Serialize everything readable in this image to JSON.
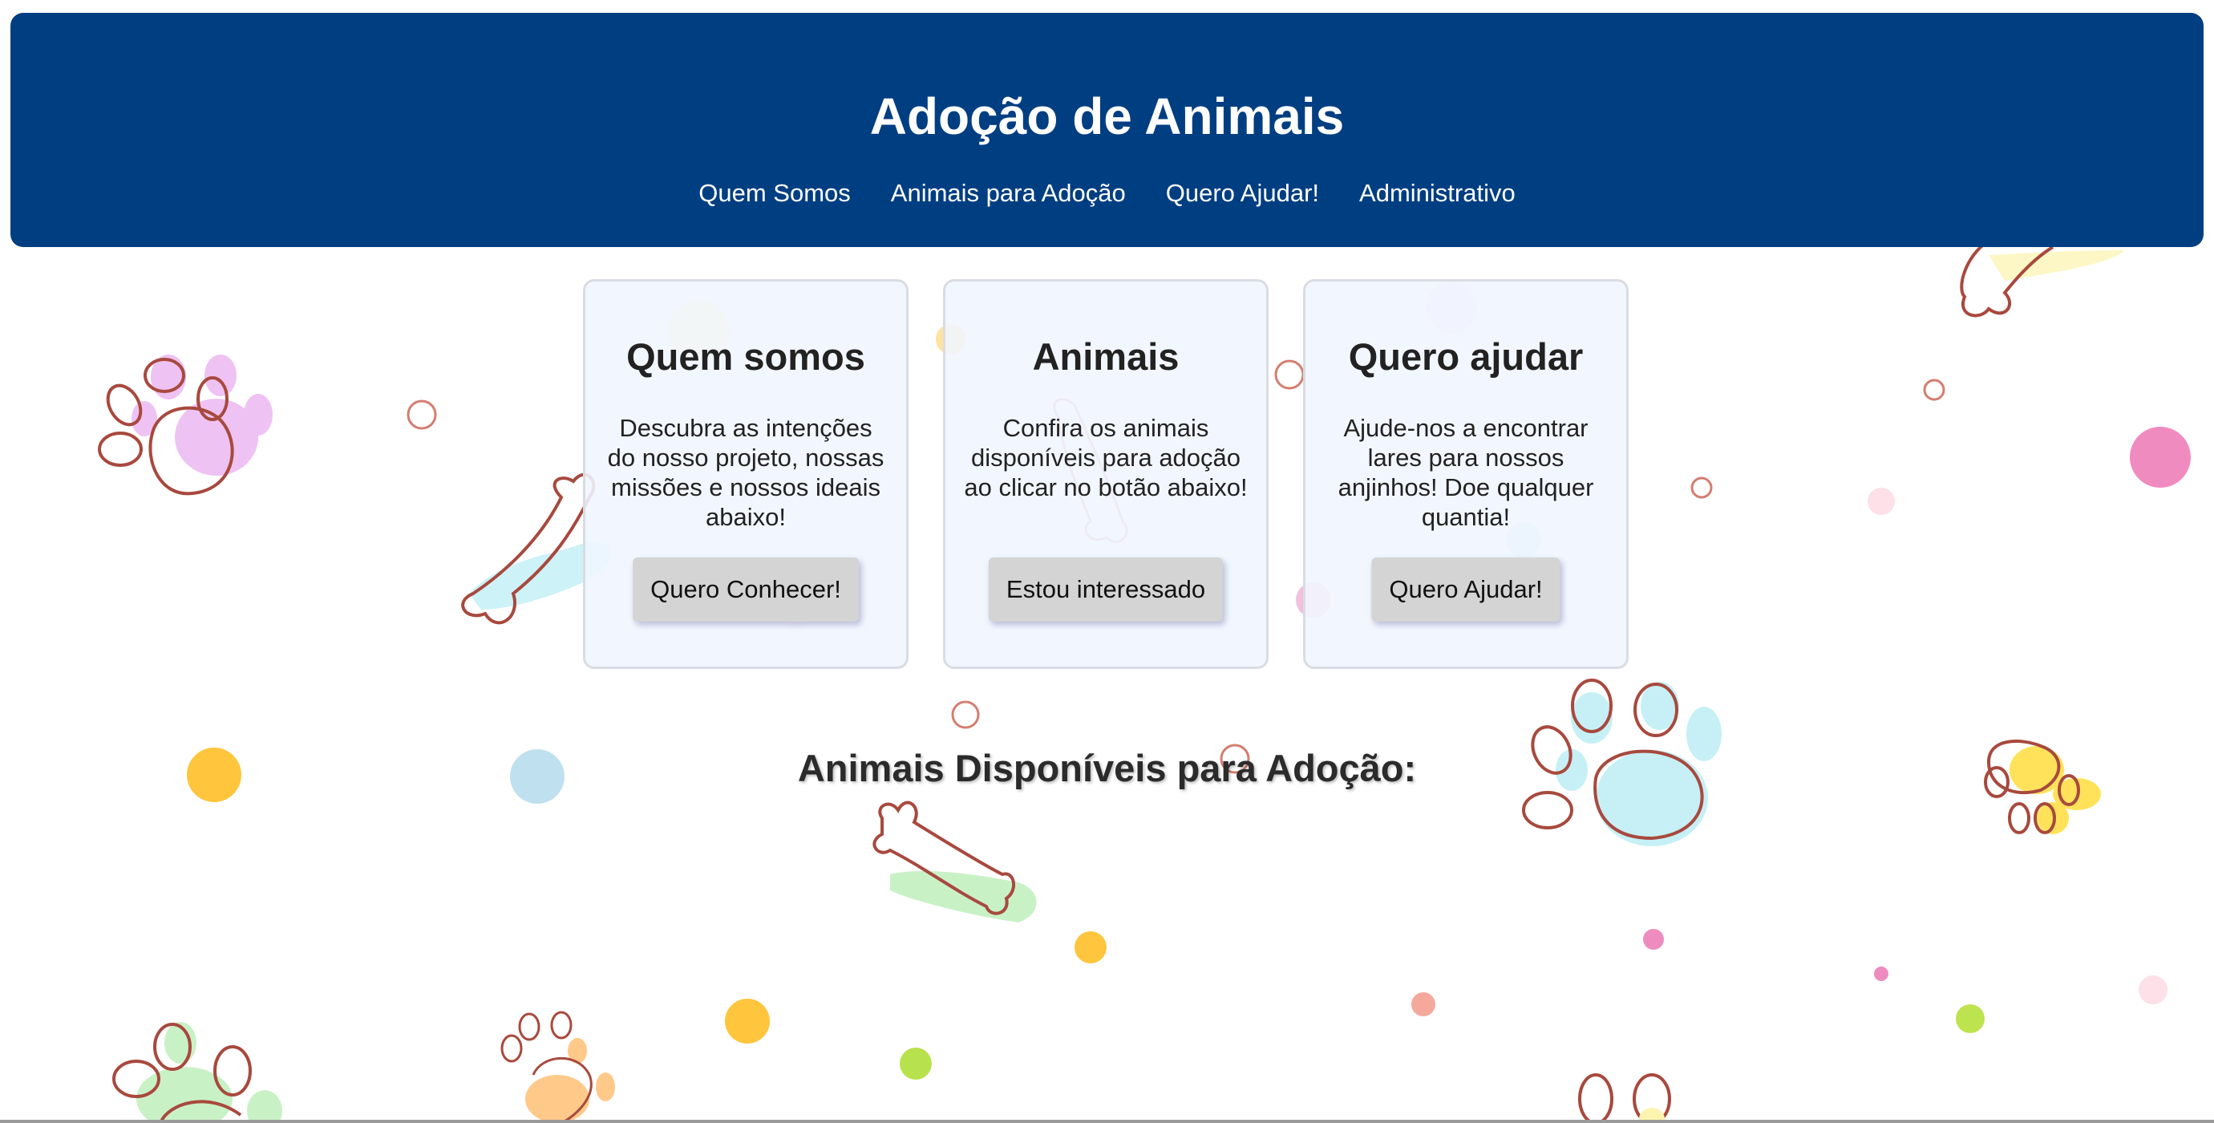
{
  "header": {
    "title": "Adoção de Animais",
    "nav": [
      {
        "label": "Quem Somos"
      },
      {
        "label": "Animais para Adoção"
      },
      {
        "label": "Quero Ajudar!"
      },
      {
        "label": "Administrativo"
      }
    ]
  },
  "cards": [
    {
      "title": "Quem somos",
      "text": "Descubra as intenções do nosso projeto, nossas missões e nossos ideais abaixo!",
      "button": "Quero Conhecer!"
    },
    {
      "title": "Animais",
      "text": "Confira os animais disponíveis para adoção ao clicar no botão abaixo!",
      "button": "Estou interessado"
    },
    {
      "title": "Quero ajudar",
      "text": "Ajude-nos a encontrar lares para nossos anjinhos! Doe qualquer quantia!",
      "button": "Quero Ajudar!"
    }
  ],
  "section": {
    "title": "Animais Disponíveis para Adoção:"
  },
  "colors": {
    "header_bg": "#003e82",
    "card_bg": "#f0f6ff",
    "button_bg": "#d4d4d4",
    "outline": "#a8493e"
  }
}
